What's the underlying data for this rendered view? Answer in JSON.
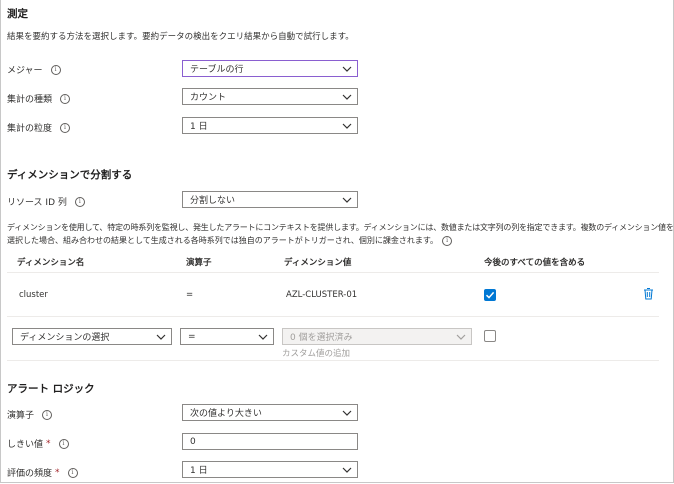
{
  "measure": {
    "title": "測定",
    "description": "結果を要約する方法を選択します。要約データの検出をクエリ結果から自動で試行します。",
    "measure_label": "メジャー",
    "measure_value": "テーブルの行",
    "aggregation_type_label": "集計の種類",
    "aggregation_type_value": "カウント",
    "granularity_label": "集計の粒度",
    "granularity_value": "1 日"
  },
  "dimensions": {
    "title": "ディメンションで分割する",
    "resource_id_label": "リソース ID 列",
    "resource_id_value": "分割しない",
    "description_line1": "ディメンションを使用して、特定の時系列を監視し、発生したアラートにコンテキストを提供します。ディメンションには、数値または文字列の列を指定できます。複数のディメンション値を",
    "description_line2": "選択した場合、組み合わせの結果として生成される各時系列では独自のアラートがトリガーされ、個別に課金されます。",
    "columns": [
      "ディメンション名",
      "演算子",
      "ディメンション値",
      "今後のすべての値を含める"
    ],
    "rows": [
      {
        "name": "cluster",
        "operator": "=",
        "value": "AZL-CLUSTER-01",
        "include_future": true
      }
    ],
    "new_row": {
      "name_placeholder": "ディメンションの選択",
      "operator_value": "=",
      "values_placeholder": "0 個を選択済み",
      "add_custom_link": "カスタム値の追加"
    }
  },
  "alert_logic": {
    "title": "アラート ロジック",
    "operator_label": "演算子",
    "operator_value": "次の値より大きい",
    "threshold_label": "しきい値",
    "threshold_value": "0",
    "frequency_label": "評価の頻度",
    "frequency_value": "1 日",
    "required_marker": "*"
  },
  "icons": {
    "info": "info-icon",
    "chevron": "chevron-down-icon",
    "delete": "trash-icon",
    "check": "checkmark-icon"
  },
  "colors": {
    "accent": "#0078d4",
    "focus_border": "#8a5fd0",
    "required": "#a4262c"
  }
}
